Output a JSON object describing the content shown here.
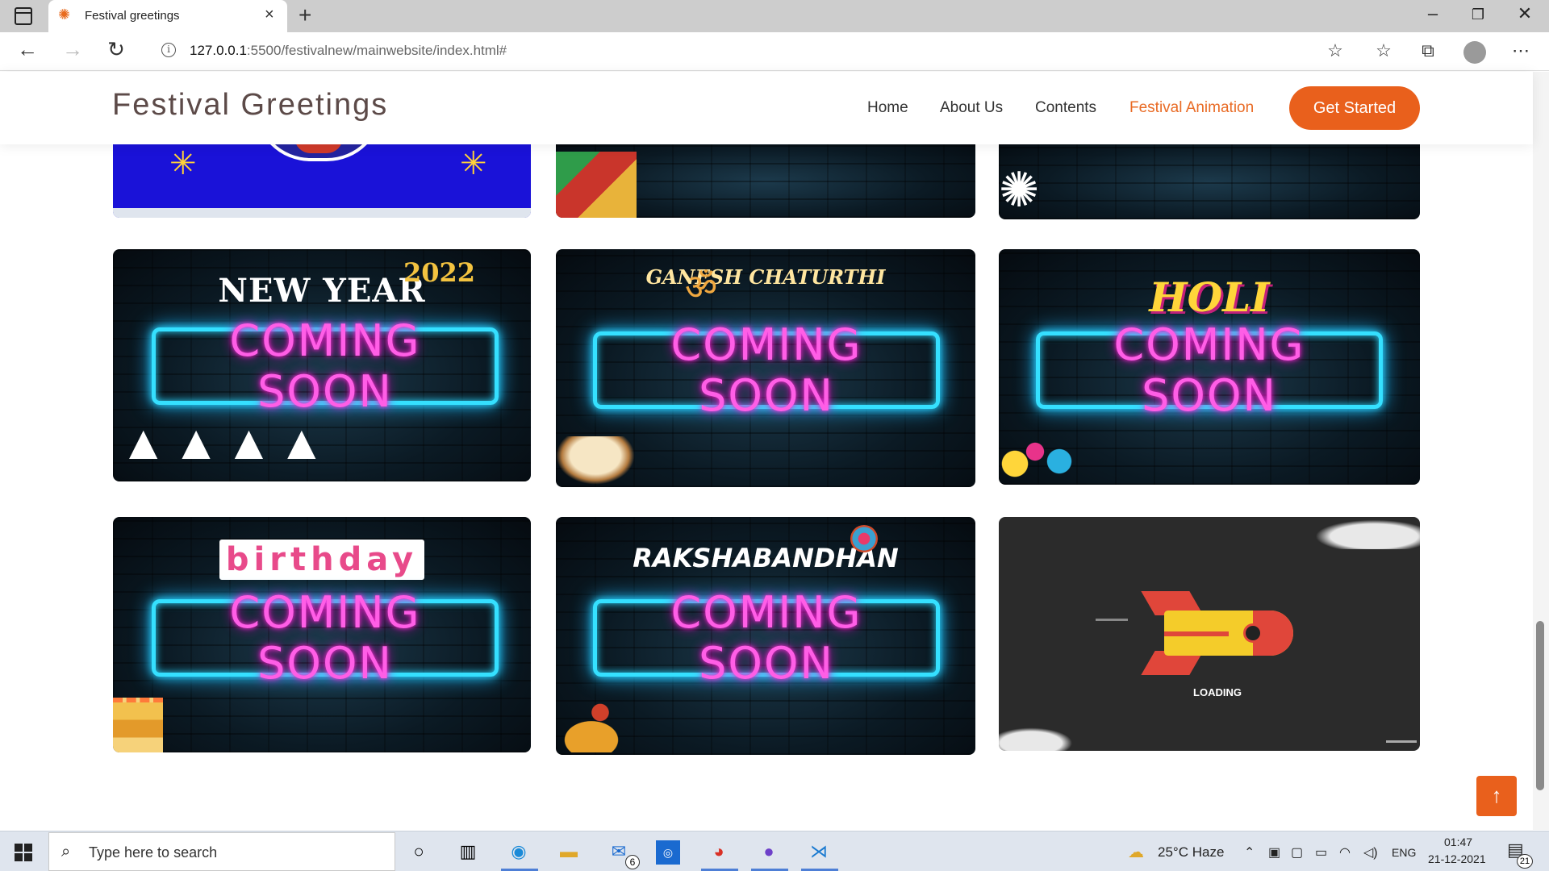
{
  "browser": {
    "tab_title": "Festival greetings",
    "url_host": "127.0.0.1",
    "url_path": ":5500/festivalnew/mainwebsite/index.html#"
  },
  "site": {
    "logo": "Festival Greetings",
    "nav": [
      "Home",
      "About Us",
      "Contents",
      "Festival Animation"
    ],
    "cta": "Get Started"
  },
  "cards": [
    {
      "title": "NEW YEAR",
      "sub": "2022",
      "label": "COMING SOON"
    },
    {
      "title": "GANESH CHATURTHI",
      "label": "COMING SOON"
    },
    {
      "title": "HOLI",
      "label": "COMING SOON"
    },
    {
      "title": "birthday",
      "label": "COMING SOON"
    },
    {
      "title": "RAKSHABANDHAN",
      "label": "COMING SOON"
    },
    {
      "title": "LOADING"
    }
  ],
  "taskbar": {
    "search_placeholder": "Type here to search",
    "weather": "25°C  Haze",
    "lang": "ENG",
    "time": "01:47",
    "date": "21-12-2021",
    "mail_badge": "6",
    "notif_badge": "21"
  },
  "colors": {
    "accent": "#e9601c",
    "neon_border": "#35e0ff",
    "neon_text": "#ff5ee6"
  }
}
